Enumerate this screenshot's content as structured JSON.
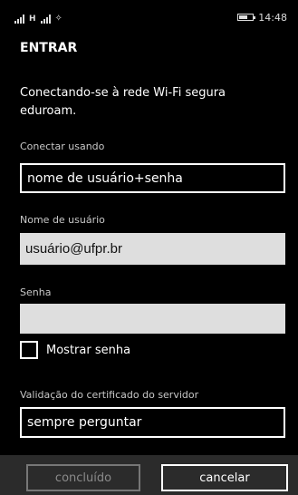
{
  "status_bar": {
    "network_label": "H",
    "wifi_icon": "wifi-icon",
    "battery_level": 0.6,
    "time": "14:48"
  },
  "header": {
    "title": "ENTRAR"
  },
  "message": "Conectando-se à rede Wi-Fi segura eduroam.",
  "connect_using": {
    "label": "Conectar usando",
    "value": "nome de usuário+senha"
  },
  "username": {
    "label": "Nome de usuário",
    "value": "usuário@ufpr.br"
  },
  "password": {
    "label": "Senha",
    "value": ""
  },
  "show_password": {
    "label": "Mostrar senha",
    "checked": false
  },
  "certificate": {
    "label": "Validação do certificado do servidor",
    "value": "sempre perguntar"
  },
  "app_bar": {
    "done_label": "concluído",
    "cancel_label": "cancelar"
  },
  "colors": {
    "background": "#000000",
    "app_bar": "#2b2b2b",
    "field_light": "#dedede"
  }
}
